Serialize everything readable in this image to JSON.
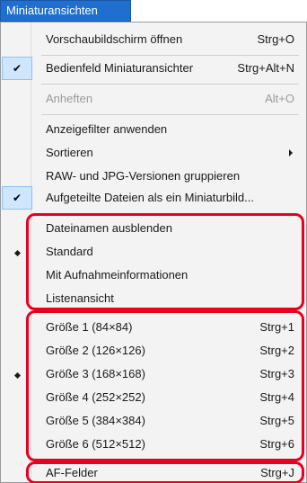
{
  "menu_title": "Miniaturansichten",
  "items": {
    "preview_screen": {
      "label": "Vorschaubildschirm öffnen",
      "shortcut": "Strg+O",
      "checked": false,
      "enabled": true
    },
    "thumb_panel": {
      "label": "Bedienfeld Miniaturansichter",
      "shortcut": "Strg+Alt+N",
      "checked": true,
      "enabled": true
    },
    "pin": {
      "label": "Anheften",
      "shortcut": "Alt+O",
      "checked": false,
      "enabled": false
    },
    "apply_filter": {
      "label": "Anzeigefilter anwenden",
      "shortcut": "",
      "checked": false,
      "enabled": true
    },
    "sort": {
      "label": "Sortieren",
      "shortcut": "",
      "has_submenu": true,
      "enabled": true
    },
    "group_raw_jpg": {
      "label": "RAW- und JPG-Versionen gruppieren",
      "shortcut": "",
      "enabled": true
    },
    "split_files": {
      "label": "Aufgeteilte Dateien als ein Miniaturbild...",
      "shortcut": "",
      "checked": true,
      "enabled": true
    },
    "hide_filenames": {
      "label": "Dateinamen ausblenden",
      "shortcut": "",
      "enabled": true
    },
    "standard": {
      "label": "Standard",
      "shortcut": "",
      "radio_selected": true,
      "enabled": true
    },
    "with_shooting_info": {
      "label": "Mit Aufnahmeinformationen",
      "shortcut": "",
      "enabled": true
    },
    "list_view": {
      "label": "Listenansicht",
      "shortcut": "",
      "enabled": true
    },
    "size1": {
      "label": "Größe 1 (84×84)",
      "shortcut": "Strg+1",
      "enabled": true
    },
    "size2": {
      "label": "Größe 2 (126×126)",
      "shortcut": "Strg+2",
      "enabled": true
    },
    "size3": {
      "label": "Größe 3 (168×168)",
      "shortcut": "Strg+3",
      "radio_selected": true,
      "enabled": true
    },
    "size4": {
      "label": "Größe 4 (252×252)",
      "shortcut": "Strg+4",
      "enabled": true
    },
    "size5": {
      "label": "Größe 5 (384×384)",
      "shortcut": "Strg+5",
      "enabled": true
    },
    "size6": {
      "label": "Größe 6 (512×512)",
      "shortcut": "Strg+6",
      "enabled": true
    },
    "af_points": {
      "label": "AF-Felder",
      "shortcut": "Strg+J",
      "enabled": true
    }
  },
  "colors": {
    "menu_tab_bg": "#1e6fd0",
    "highlight_border": "#e8001f",
    "check_bg": "#cfe6ff"
  },
  "icons": {
    "check": "checkmark-icon",
    "radio": "radio-dot-icon",
    "submenu": "submenu-arrow-icon"
  }
}
